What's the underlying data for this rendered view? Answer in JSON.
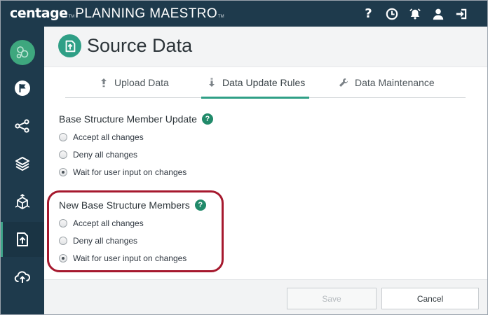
{
  "app": {
    "brand_name": "centage",
    "brand_tm": "TM",
    "product_name": "PLANNING MAESTRO",
    "product_tm": "TM",
    "top_icons": [
      "help-icon",
      "clock-icon",
      "alarm-bell-icon",
      "user-icon",
      "sign-out-icon"
    ],
    "help_glyph": "?"
  },
  "sidebar": {
    "items": [
      "dashboard-logo-icon",
      "flag-icon",
      "share-icon",
      "layers-icon",
      "cube-icon",
      "upload-file-icon",
      "cloud-upload-icon"
    ],
    "active": "upload-file-icon"
  },
  "page": {
    "title": "Source Data",
    "tabs": [
      {
        "label": "Upload Data",
        "icon": "upload-arrow-icon"
      },
      {
        "label": "Data Update Rules",
        "icon": "download-arrow-icon"
      },
      {
        "label": "Data Maintenance",
        "icon": "wrench-icon"
      }
    ],
    "active_tab": "Data Update Rules"
  },
  "sections": [
    {
      "title": "Base Structure Member Update",
      "help": "?",
      "options": [
        "Accept all changes",
        "Deny all changes",
        "Wait for user input on changes"
      ],
      "selected": "Wait for user input on changes"
    },
    {
      "title": "New Base Structure Members",
      "help": "?",
      "options": [
        "Accept all changes",
        "Deny all changes",
        "Wait for user input on changes"
      ],
      "selected": "Wait for user input on changes"
    }
  ],
  "footer": {
    "save_label": "Save",
    "cancel_label": "Cancel",
    "save_disabled": true
  },
  "colors": {
    "nav_bg": "#1e3a4c",
    "accent": "#2f9f86",
    "highlight": "#a6192e"
  }
}
